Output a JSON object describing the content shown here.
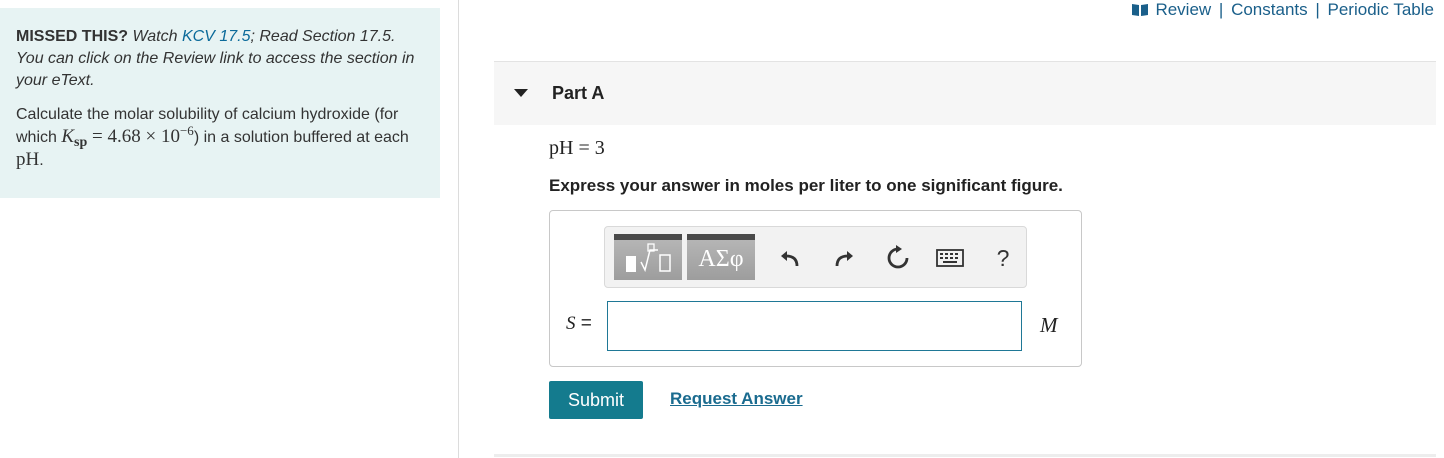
{
  "sidebar": {
    "missed_lead": "MISSED THIS?",
    "missed_watch": "Watch",
    "missed_kcv_link": "KCV 17.5",
    "missed_rest": "; Read Section 17.5. You can click on the Review link to access the section in your eText.",
    "question_prefix": "Calculate the molar solubility of calcium hydroxide (for which",
    "ksp_symbol": "K",
    "ksp_sub": "sp",
    "ksp_value": "= 4.68 × 10",
    "ksp_exp": "−6",
    "question_middle": ") in a solution buffered at each",
    "question_ph": "pH",
    "question_end": "."
  },
  "top_links": {
    "review": "Review",
    "constants": "Constants",
    "periodic_table": "Periodic Table",
    "separator": "|"
  },
  "part": {
    "title": "Part A",
    "condition": "pH = 3",
    "instruction": "Express your answer in moles per liter to one significant figure."
  },
  "answer": {
    "variable_label": "S",
    "equals": "=",
    "value": "",
    "unit": "M",
    "greek_label": "ΑΣφ",
    "help_label": "?"
  },
  "actions": {
    "submit_label": "Submit",
    "request_answer_label": "Request Answer"
  },
  "colors": {
    "sidebar_bg": "#e7f3f3",
    "link": "#1a5f8a",
    "submit_bg": "#147b8e",
    "input_border": "#1f7896"
  },
  "icons": {
    "book": "book-icon",
    "caret": "caret-down-icon",
    "templates": "fraction-root-template-icon",
    "undo": "undo-icon",
    "redo": "redo-icon",
    "reset": "reset-icon",
    "keyboard": "keyboard-icon",
    "help": "help-icon"
  }
}
